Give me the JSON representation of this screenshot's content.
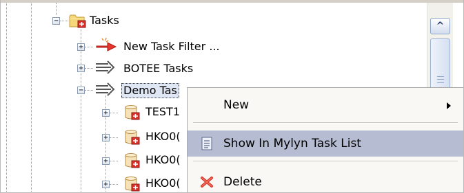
{
  "tree": {
    "root": {
      "label": "Tasks",
      "expanded": true,
      "icon": "task-folder-icon"
    },
    "children": [
      {
        "label": "New Task Filter ...",
        "icon": "new-filter-arrow-icon",
        "expanded": false
      },
      {
        "label": "BOTEE Tasks",
        "icon": "task-query-icon",
        "expanded": false
      },
      {
        "label": "Demo Tas",
        "icon": "task-query-icon",
        "expanded": true,
        "selected": true
      }
    ],
    "grandchildren": [
      {
        "label": "TEST1",
        "icon": "task-repository-icon"
      },
      {
        "label": "HKO0(",
        "icon": "task-repository-icon"
      },
      {
        "label": "HKO0(",
        "icon": "task-repository-icon"
      },
      {
        "label": "HKO0(",
        "icon": "task-repository-icon"
      }
    ]
  },
  "context_menu": {
    "items": [
      {
        "label": "New",
        "has_submenu": true,
        "icon": ""
      },
      {
        "label": "Show In Mylyn Task List",
        "highlighted": true,
        "icon": "task-list-icon"
      },
      {
        "label": "Delete",
        "icon": "delete-x-icon"
      }
    ]
  },
  "scrollbar": {
    "up_glyph": "^"
  },
  "colors": {
    "menu_highlight": "#b6bdd2",
    "menu_background": "#f9f8f4",
    "selection": "#dfe7f5"
  }
}
